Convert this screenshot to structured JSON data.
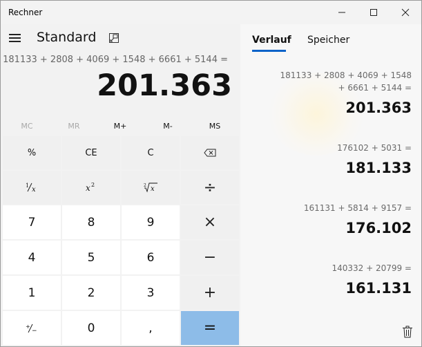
{
  "window": {
    "title": "Rechner",
    "minimize_glyph": "—",
    "close_glyph": "✕"
  },
  "header": {
    "mode_title": "Standard"
  },
  "display": {
    "expression": "181133 + 2808 + 4069 + 1548 + 6661 + 5144 =",
    "result": "201.363"
  },
  "memory": {
    "mc": "MC",
    "mr": "MR",
    "m_plus": "M+",
    "m_minus": "M-",
    "ms": "MS"
  },
  "keys": {
    "percent": "%",
    "ce": "CE",
    "c": "C",
    "divide": "÷",
    "multiply": "×",
    "minus": "−",
    "plus": "+",
    "equals": "=",
    "n7": "7",
    "n8": "8",
    "n9": "9",
    "n4": "4",
    "n5": "5",
    "n6": "6",
    "n1": "1",
    "n2": "2",
    "n3": "3",
    "n0": "0",
    "decimal": ","
  },
  "tabs": {
    "history": "Verlauf",
    "memory": "Speicher"
  },
  "history": [
    {
      "expr_line1": "181133   +   2808   +   4069   +   1548",
      "expr_line2": "+   6661   +   5144  =",
      "result": "201.363"
    },
    {
      "expr_line1": "176102   +   5031  =",
      "result": "181.133"
    },
    {
      "expr_line1": "161131   +   5814   +   9157  =",
      "result": "176.102"
    },
    {
      "expr_line1": "140332   +   20799  =",
      "result": "161.131"
    }
  ],
  "icons": {
    "menu": "hamburger-icon",
    "keep_on_top": "keep-on-top-icon",
    "backspace": "backspace-icon",
    "trash": "trash-icon"
  },
  "colors": {
    "accent": "#0a63c9",
    "equals_key": "#8dbce8",
    "number_key": "#ffffff",
    "function_key": "#f0f0f0"
  }
}
